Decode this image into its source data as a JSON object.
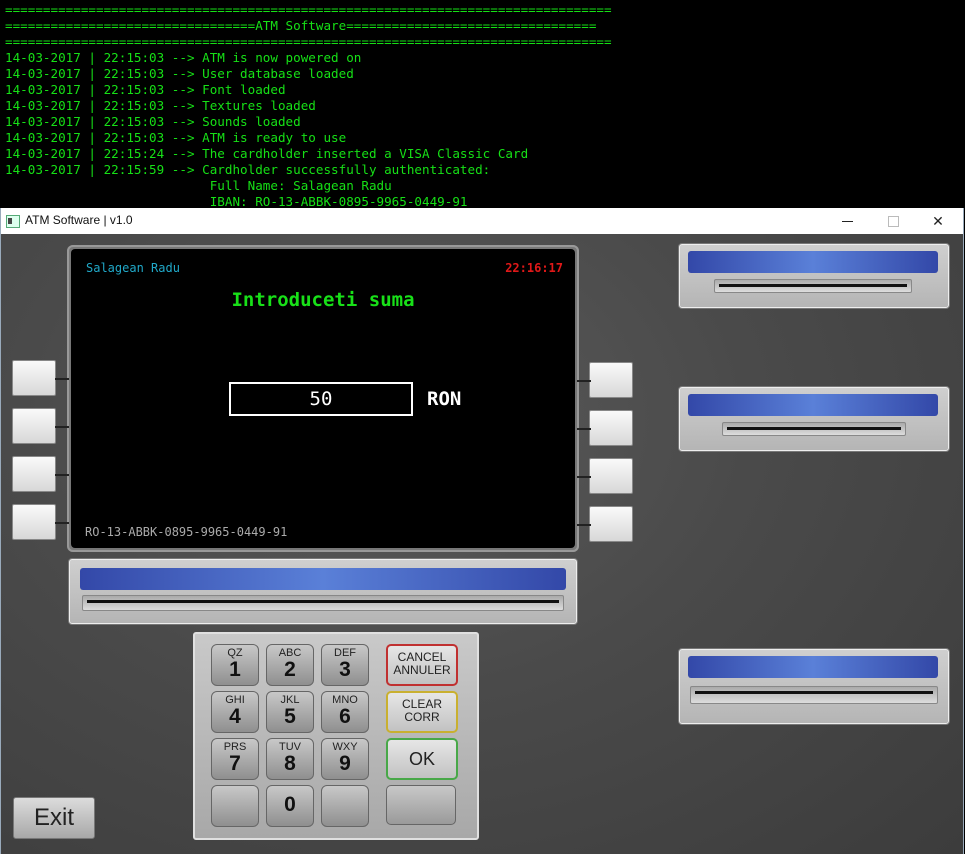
{
  "console": {
    "lines": [
      "================================================================================",
      "=================================ATM Software=================================",
      "================================================================================",
      "14-03-2017 | 22:15:03 --> ATM is now powered on",
      "14-03-2017 | 22:15:03 --> User database loaded",
      "14-03-2017 | 22:15:03 --> Font loaded",
      "14-03-2017 | 22:15:03 --> Textures loaded",
      "14-03-2017 | 22:15:03 --> Sounds loaded",
      "14-03-2017 | 22:15:03 --> ATM is ready to use",
      "14-03-2017 | 22:15:24 --> The cardholder inserted a VISA Classic Card",
      "14-03-2017 | 22:15:59 --> Cardholder successfully authenticated:",
      "                           Full Name: Salagean Radu",
      "                           IBAN: RO-13-ABBK-0895-9965-0449-91"
    ]
  },
  "window": {
    "title": "ATM Software | v1.0",
    "minimize": "",
    "maximize": "",
    "close": "✕"
  },
  "screen": {
    "cardholder": "Salagean Radu",
    "clock": "22:16:17",
    "prompt": "Introduceti suma",
    "amount": "50",
    "currency": "RON",
    "iban": "RO-13-ABBK-0895-9965-0449-91"
  },
  "keypad": {
    "keys": [
      {
        "sub": "QZ",
        "digit": "1"
      },
      {
        "sub": "ABC",
        "digit": "2"
      },
      {
        "sub": "DEF",
        "digit": "3"
      },
      {
        "sub": "GHI",
        "digit": "4"
      },
      {
        "sub": "JKL",
        "digit": "5"
      },
      {
        "sub": "MNO",
        "digit": "6"
      },
      {
        "sub": "PRS",
        "digit": "7"
      },
      {
        "sub": "TUV",
        "digit": "8"
      },
      {
        "sub": "WXY",
        "digit": "9"
      },
      {
        "sub": "",
        "digit": "0"
      }
    ],
    "cancel_line1": "CANCEL",
    "cancel_line2": "ANNULER",
    "clear_line1": "CLEAR",
    "clear_line2": "CORR",
    "ok": "OK"
  },
  "exit_label": "Exit",
  "colors": {
    "console_text": "#16e016",
    "screen_prompt": "#18e018",
    "clock": "#e01818",
    "cardholder": "#20a8c8",
    "slot_band": "#4a68c8"
  }
}
